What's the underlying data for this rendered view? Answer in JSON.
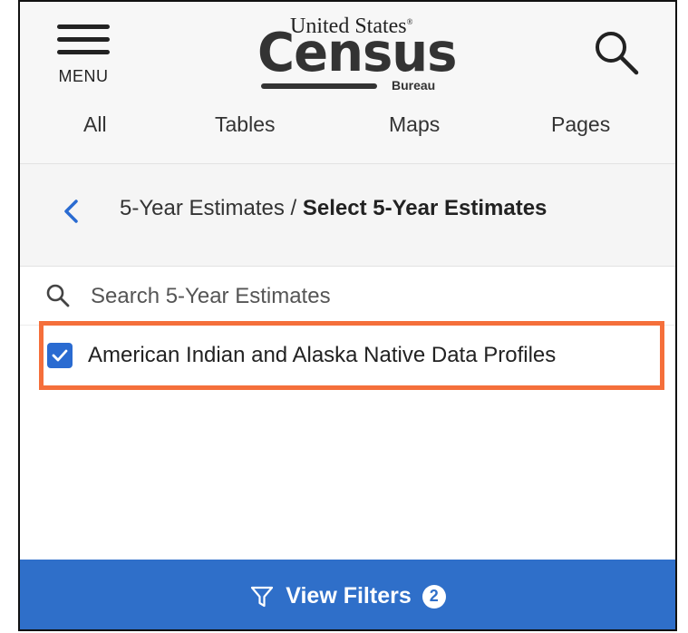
{
  "header": {
    "menu_label": "MENU",
    "logo": {
      "top": "United States",
      "main": "Census",
      "sub": "Bureau"
    },
    "icons": {
      "menu": "hamburger-icon",
      "search": "search-icon"
    }
  },
  "tabs": [
    {
      "label": "All"
    },
    {
      "label": "Tables"
    },
    {
      "label": "Maps"
    },
    {
      "label": "Pages"
    }
  ],
  "breadcrumb": {
    "parent": "5-Year Estimates",
    "separator": " / ",
    "current": "Select 5-Year Estimates"
  },
  "search": {
    "placeholder": "Search 5-Year Estimates",
    "value": ""
  },
  "list": {
    "items": [
      {
        "label": "American Indian and Alaska Native Data Profiles",
        "checked": true
      }
    ]
  },
  "footer": {
    "label": "View Filters",
    "count": "2",
    "icon": "filter-icon"
  },
  "colors": {
    "accent": "#2f6fc9",
    "checkbox": "#2a6bd1",
    "highlight": "#f56f3b"
  }
}
